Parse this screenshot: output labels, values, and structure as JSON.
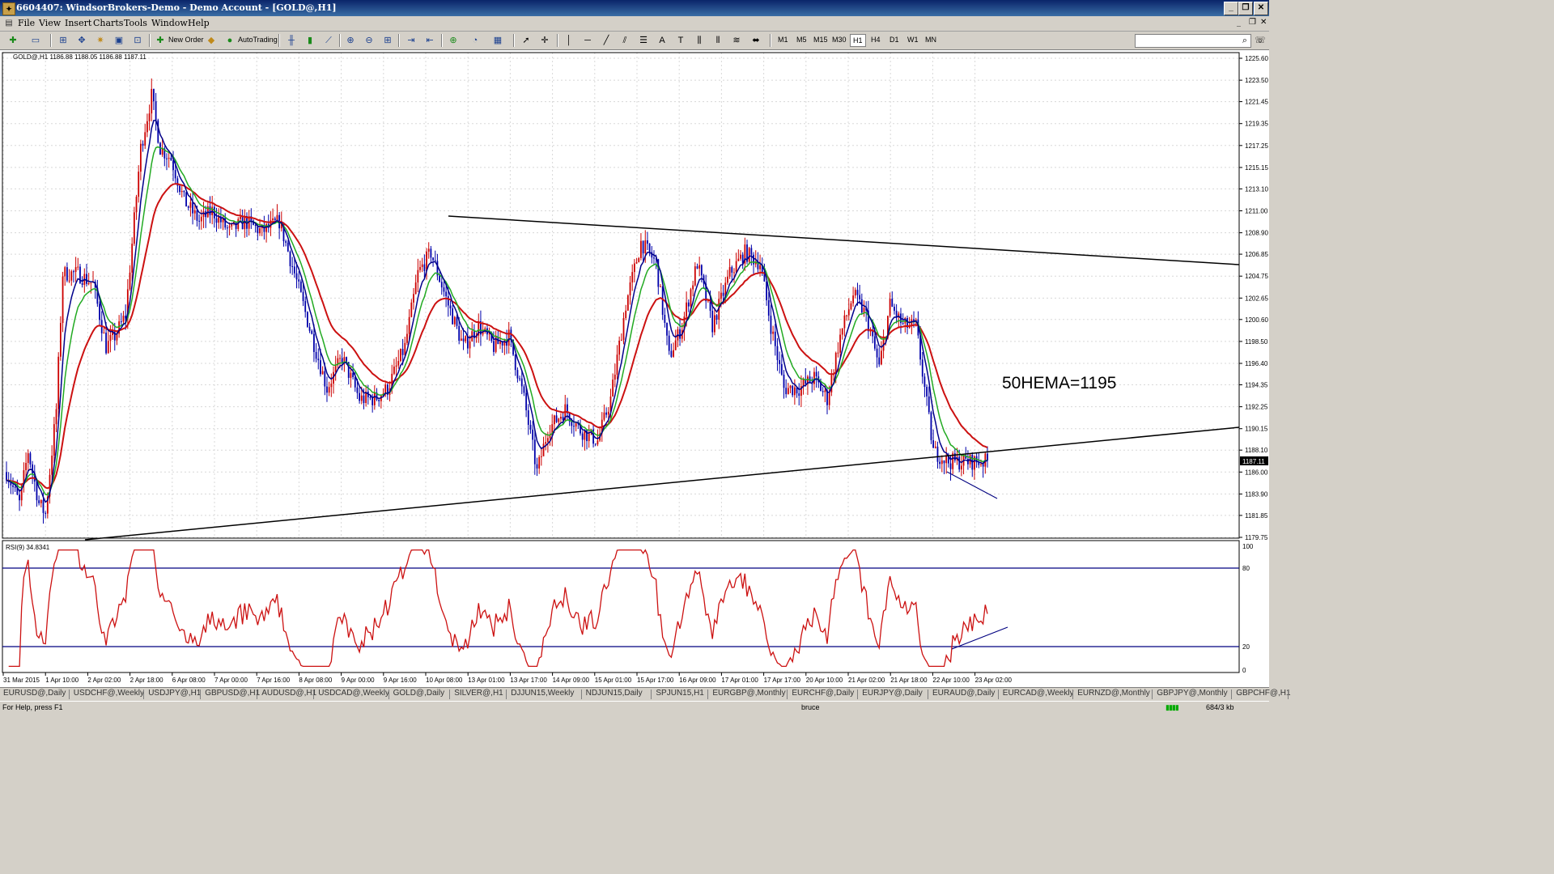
{
  "window": {
    "title": "6604407: WindsorBrokers-Demo - Demo Account - [GOLD@,H1]"
  },
  "menu": [
    "File",
    "View",
    "Insert",
    "Charts",
    "Tools",
    "Window",
    "Help"
  ],
  "toolbar": {
    "new_order": "New Order",
    "autotrading": "AutoTrading",
    "timeframes": [
      "M1",
      "M5",
      "M15",
      "M30",
      "H1",
      "H4",
      "D1",
      "W1",
      "MN"
    ],
    "active_timeframe": "H1"
  },
  "chart": {
    "header": "GOLD@,H1  1186.88 1188.05 1186.88 1187.11",
    "annotation": "50HEMA=1195",
    "current_price": "1187.11",
    "rsi_header": "RSI(9) 34.8341",
    "rsi_levels": [
      "100",
      "80",
      "20",
      "0"
    ],
    "price_ticks": [
      "1225.60",
      "1223.50",
      "1221.45",
      "1219.35",
      "1217.25",
      "1215.15",
      "1213.10",
      "1211.00",
      "1208.90",
      "1206.85",
      "1204.75",
      "1202.65",
      "1200.60",
      "1198.50",
      "1196.40",
      "1194.35",
      "1192.25",
      "1190.15",
      "1188.10",
      "1186.00",
      "1183.90",
      "1181.85",
      "1179.75"
    ],
    "time_ticks": [
      "31 Mar 2015",
      "1 Apr 10:00",
      "2 Apr 02:00",
      "2 Apr 18:00",
      "6 Apr 08:00",
      "7 Apr 00:00",
      "7 Apr 16:00",
      "8 Apr 08:00",
      "9 Apr 00:00",
      "9 Apr 16:00",
      "10 Apr 08:00",
      "13 Apr 01:00",
      "13 Apr 17:00",
      "14 Apr 09:00",
      "15 Apr 01:00",
      "15 Apr 17:00",
      "16 Apr 09:00",
      "17 Apr 01:00",
      "17 Apr 17:00",
      "20 Apr 10:00",
      "21 Apr 02:00",
      "21 Apr 18:00",
      "22 Apr 10:00",
      "23 Apr 02:00"
    ],
    "colors": {
      "candle_up": "#cc0000",
      "candle_down": "#0000aa",
      "ema_fast": "#00008b",
      "ema_mid": "#22aa22",
      "ema_slow": "#cc1111",
      "rsi": "#cc1111",
      "trendline": "#000000"
    }
  },
  "tabs": [
    "EURUSD@,Daily",
    "USDCHF@,Weekly",
    "USDJPY@,H1",
    "GBPUSD@,H1",
    "AUDUSD@,H1",
    "USDCAD@,Weekly",
    "GOLD@,Daily",
    "SILVER@,H1",
    "DJJUN15,Weekly",
    "NDJUN15,Daily",
    "SPJUN15,H1",
    "EURGBP@,Monthly",
    "EURCHF@,Daily",
    "EURJPY@,Daily",
    "EURAUD@,Daily",
    "EURCAD@,Weekly",
    "EURNZD@,Monthly",
    "GBPJPY@,Monthly",
    "GBPCHF@,H1"
  ],
  "status": {
    "help": "For Help, press F1",
    "profile": "bruce",
    "traffic": "684/3 kb"
  }
}
